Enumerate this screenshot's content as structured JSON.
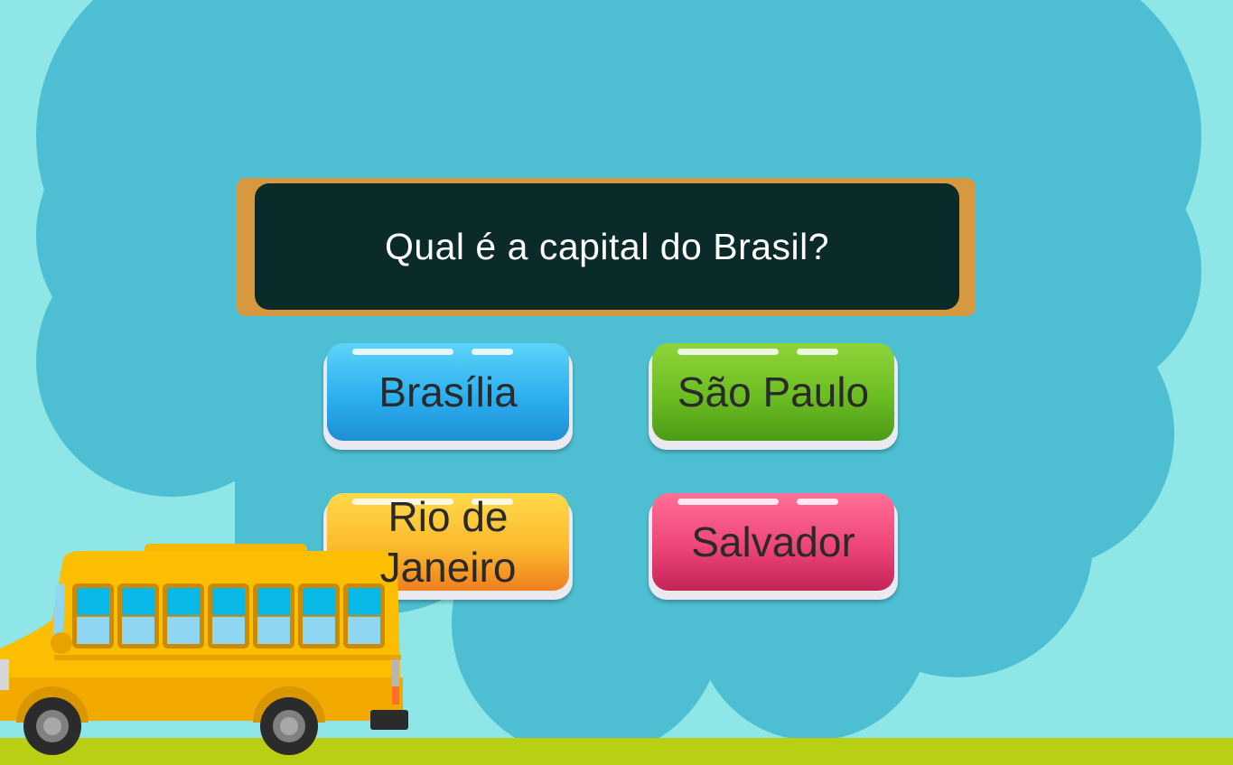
{
  "question": {
    "text": "Qual é a capital do Brasil?"
  },
  "answers": [
    {
      "label": "Brasília",
      "color": "#2cb0ef"
    },
    {
      "label": "São Paulo",
      "color": "#6bbd22"
    },
    {
      "label": "Rio de Janeiro",
      "color": "#fbbb2d"
    },
    {
      "label": "Salvador",
      "color": "#ee4579"
    }
  ],
  "icons": {
    "bus": "school-bus-icon",
    "cloud": "cloud-icon"
  }
}
